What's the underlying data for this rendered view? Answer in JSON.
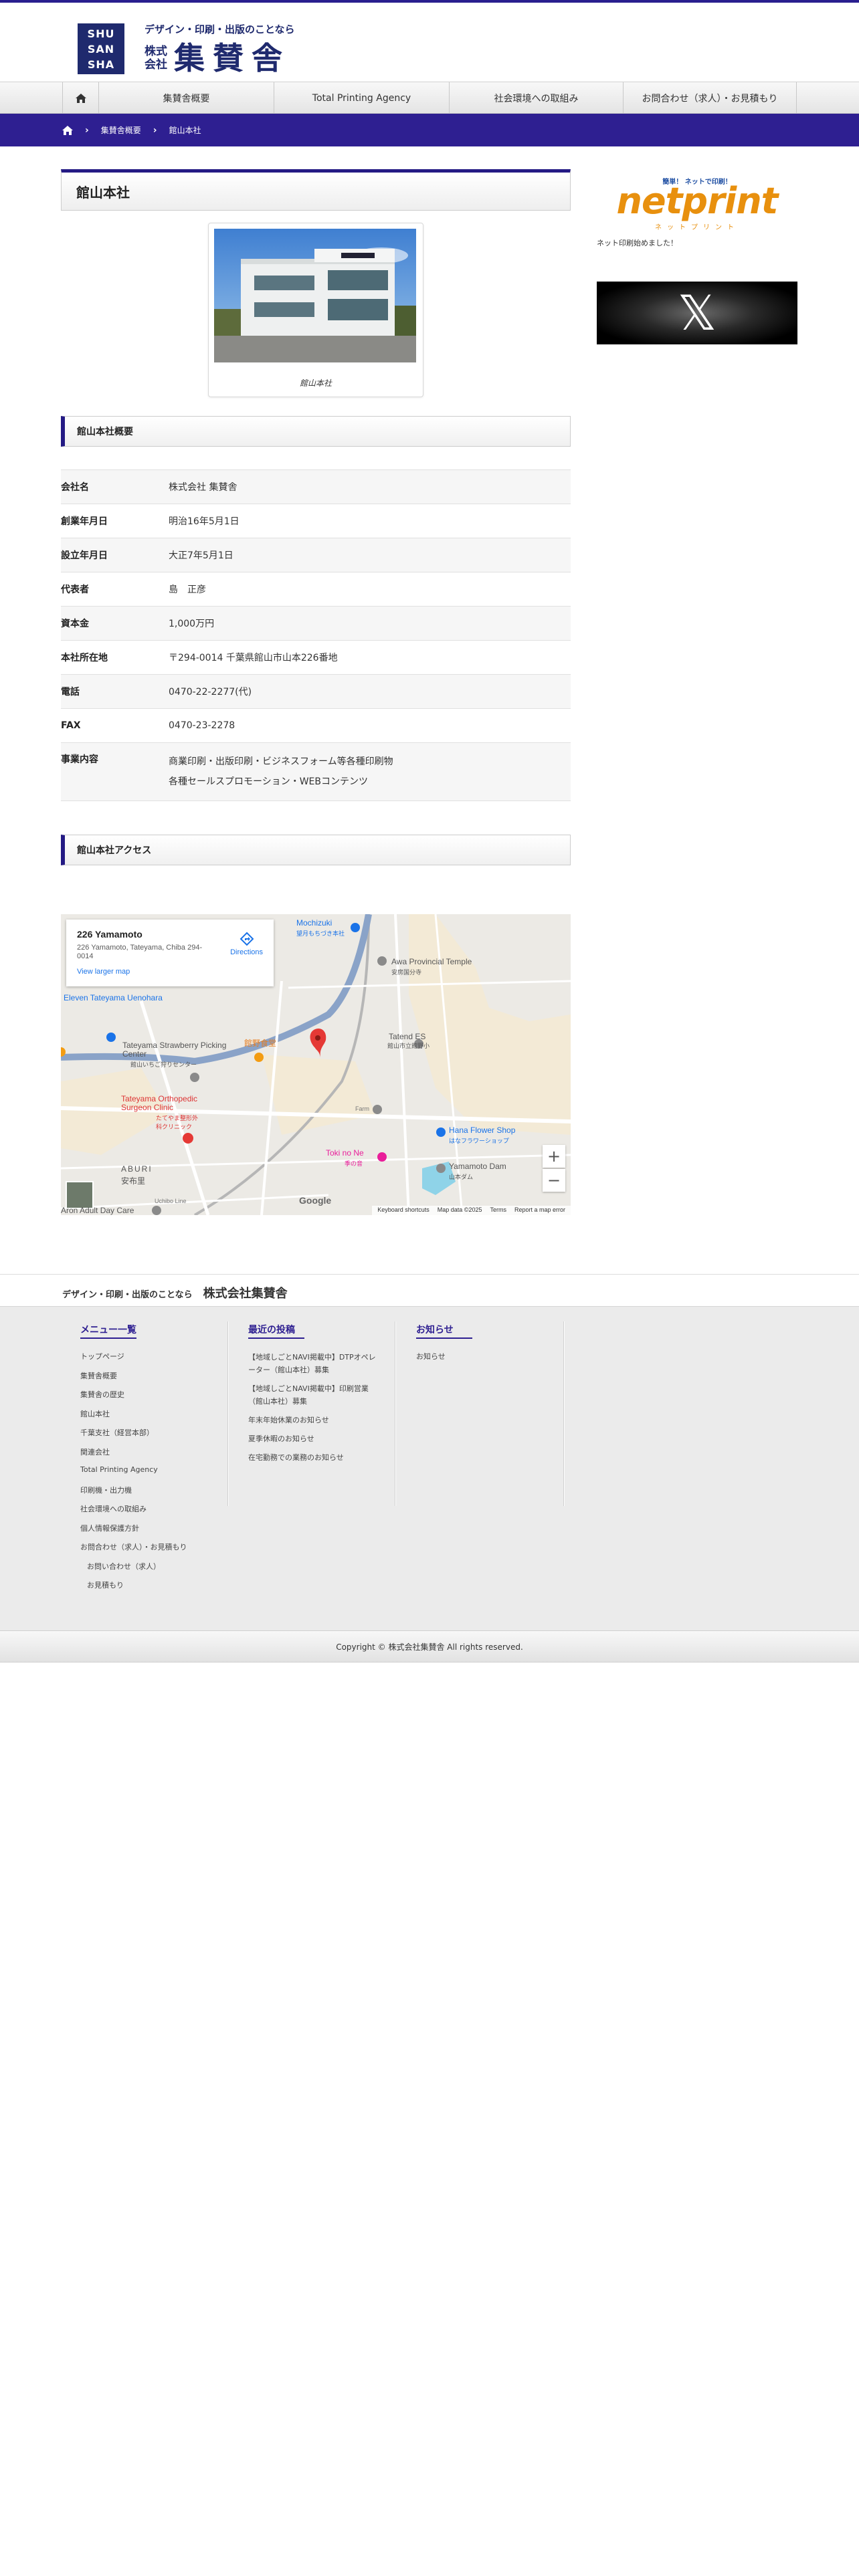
{
  "colors": {
    "brand": "#2e1f91",
    "brand_dark": "#1f2a6e",
    "netprint_orange": "#e8900e"
  },
  "header": {
    "logo_mark": [
      "SHU",
      "SAN",
      "SHA"
    ],
    "tagline": "デザイン・印刷・出版のことなら",
    "kabushiki": "株式会社",
    "company_name": "集賛舎"
  },
  "nav": {
    "home_icon": "home-icon",
    "items": [
      "集賛舎概要",
      "Total Printing Agency",
      "社会環境への取組み",
      "お問合わせ（求人）・お見積もり"
    ]
  },
  "breadcrumb": {
    "items": [
      "集賛舎概要",
      "館山本社"
    ]
  },
  "page": {
    "title": "館山本社",
    "photo_caption": "館山本社"
  },
  "overview": {
    "heading": "館山本社概要",
    "rows": [
      {
        "label": "会社名",
        "value": "株式会社 集賛舎"
      },
      {
        "label": "創業年月日",
        "value": "明治16年5月1日"
      },
      {
        "label": "設立年月日",
        "value": "大正7年5月1日"
      },
      {
        "label": "代表者",
        "value": "島　正彦"
      },
      {
        "label": "資本金",
        "value": "1,000万円"
      },
      {
        "label": "本社所在地",
        "value": "〒294-0014 千葉県館山市山本226番地"
      },
      {
        "label": "電話",
        "value": "0470-22-2277(代)"
      },
      {
        "label": "FAX",
        "value": "0470-23-2278"
      },
      {
        "label": "事業内容",
        "value": "商業印刷・出版印刷・ビジネスフォーム等各種印刷物",
        "value2": "各種セールスプロモーション・WEBコンテンツ"
      }
    ]
  },
  "access": {
    "heading": "館山本社アクセス",
    "map": {
      "card_title": "226 Yamamoto",
      "card_address": "226 Yamamoto, Tateyama, Chiba 294-0014",
      "directions": "Directions",
      "larger_map": "View larger map",
      "labels": {
        "mochizuki": "Mochizuki",
        "mochizuki_jp": "望月もちづき本社",
        "awa": "Awa Provincial Temple",
        "awa_jp": "安房国分寺",
        "eleven": "Eleven Tateyama Uenohara",
        "strawberry": "Tateyama Strawberry Picking Center",
        "strawberry_jp": "館山いちご狩りセンター",
        "tateyama_jp": "館野食堂",
        "ortho": "Tateyama Orthopedic Surgeon Clinic",
        "ortho_jp": "たてやま整形外科クリニック",
        "tatend": "Tatend ES",
        "tatend_jp": "館山市立館野小",
        "hana": "Hana Flower Shop",
        "hana_jp": "はなフラワーショップ",
        "toki": "Toki no Ne",
        "toki_jp": "季の音",
        "dam": "Yamamoto Dam",
        "dam_jp": "山本ダム",
        "farm": "Farm",
        "aburi": "ABURI",
        "aburi_jp": "安布里",
        "adult": "Aron Adult Day Care",
        "road": "Uchibo Line"
      },
      "zoom_in": "+",
      "zoom_out": "−",
      "google": "Google",
      "footer": [
        "Keyboard shortcuts",
        "Map data ©2025",
        "Terms",
        "Report a map error"
      ]
    }
  },
  "sidebar": {
    "netprint_top": "簡単！ ネットで印刷！",
    "netprint_logo": "netprint",
    "netprint_sub": "ネットプリント",
    "netprint_text": "ネット印刷始めました！",
    "x_logo": "𝕏"
  },
  "footer": {
    "tagline": "デザイン・印刷・出版のことなら",
    "company": "株式会社集賛舎",
    "menu": {
      "title": "メニュー一覧",
      "items": [
        "トップページ",
        "集賛舎概要",
        "集賛舎の歴史",
        "館山本社",
        "千葉支社（経営本部）",
        "関連会社",
        "Total Printing Agency",
        "印刷機・出力機",
        "社会環境への取組み",
        "個人情報保護方針",
        "お問合わせ（求人）・お見積もり"
      ],
      "sub_items": [
        "お問い合わせ（求人）",
        "お見積もり"
      ]
    },
    "recent": {
      "title": "最近の投稿",
      "items": [
        "【地域しごとNAVI掲載中】DTPオペレーター（館山本社）募集",
        "【地域しごとNAVI掲載中】印刷営業（館山本社）募集",
        "年末年始休業のお知らせ",
        "夏季休暇のお知らせ",
        "在宅勤務での業務のお知らせ"
      ]
    },
    "news": {
      "title": "お知らせ",
      "items": [
        "お知らせ"
      ]
    }
  },
  "copyright": "Copyright ©   株式会社集賛舎 All rights reserved."
}
